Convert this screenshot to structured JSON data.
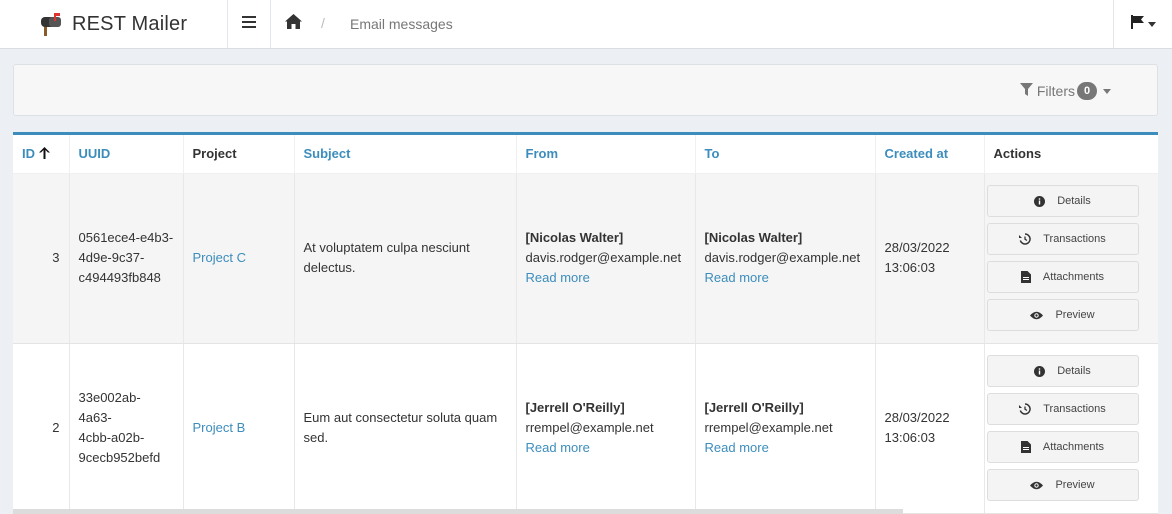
{
  "app": {
    "title": "REST Mailer"
  },
  "breadcrumb": {
    "separator": "/",
    "current": "Email messages"
  },
  "filters": {
    "label": "Filters",
    "count": "0"
  },
  "table": {
    "headers": {
      "id": "ID",
      "uuid": "UUID",
      "project": "Project",
      "subject": "Subject",
      "from": "From",
      "to": "To",
      "created_at": "Created at",
      "actions": "Actions"
    },
    "sort": {
      "column": "id",
      "direction": "ascending"
    },
    "rows": [
      {
        "id": "3",
        "uuid": [
          "0561ece4-e4b3-",
          "4d9e-9c37-",
          "c494493fb848"
        ],
        "project": "Project C",
        "subject": [
          "At voluptatem culpa nesciunt",
          "delectus."
        ],
        "from": {
          "name": "[Nicolas Walter]",
          "email": "davis.rodger@example.net",
          "link": "Read more"
        },
        "to": {
          "name": "[Nicolas Walter]",
          "email": "davis.rodger@example.net",
          "link": "Read more"
        },
        "created_at": [
          "28/03/2022",
          "13:06:03"
        ]
      },
      {
        "id": "2",
        "uuid": [
          "33e002ab-4a63-",
          "4cbb-a02b-",
          "9cecb952befd"
        ],
        "project": "Project B",
        "subject": [
          "Eum aut consectetur soluta quam",
          "sed."
        ],
        "from": {
          "name": "[Jerrell O'Reilly]",
          "email": "rrempel@example.net",
          "link": "Read more"
        },
        "to": {
          "name": "[Jerrell O'Reilly]",
          "email": "rrempel@example.net",
          "link": "Read more"
        },
        "created_at": [
          "28/03/2022",
          "13:06:03"
        ]
      }
    ],
    "action_buttons": {
      "details": "Details",
      "transactions": "Transactions",
      "attachments": "Attachments",
      "preview": "Preview"
    }
  },
  "icons": {
    "brand": "mailbox-icon",
    "menu": "hamburger-icon",
    "home": "home-icon",
    "language": "flag-icon",
    "filter": "filter-icon",
    "sort": "arrow-up-icon",
    "details": "info-circle-icon",
    "transactions": "history-icon",
    "attachments": "file-icon",
    "preview": "eye-icon"
  },
  "colors": {
    "accent": "#3c8dbc",
    "background": "#ecf0f5",
    "badge": "#777777"
  }
}
